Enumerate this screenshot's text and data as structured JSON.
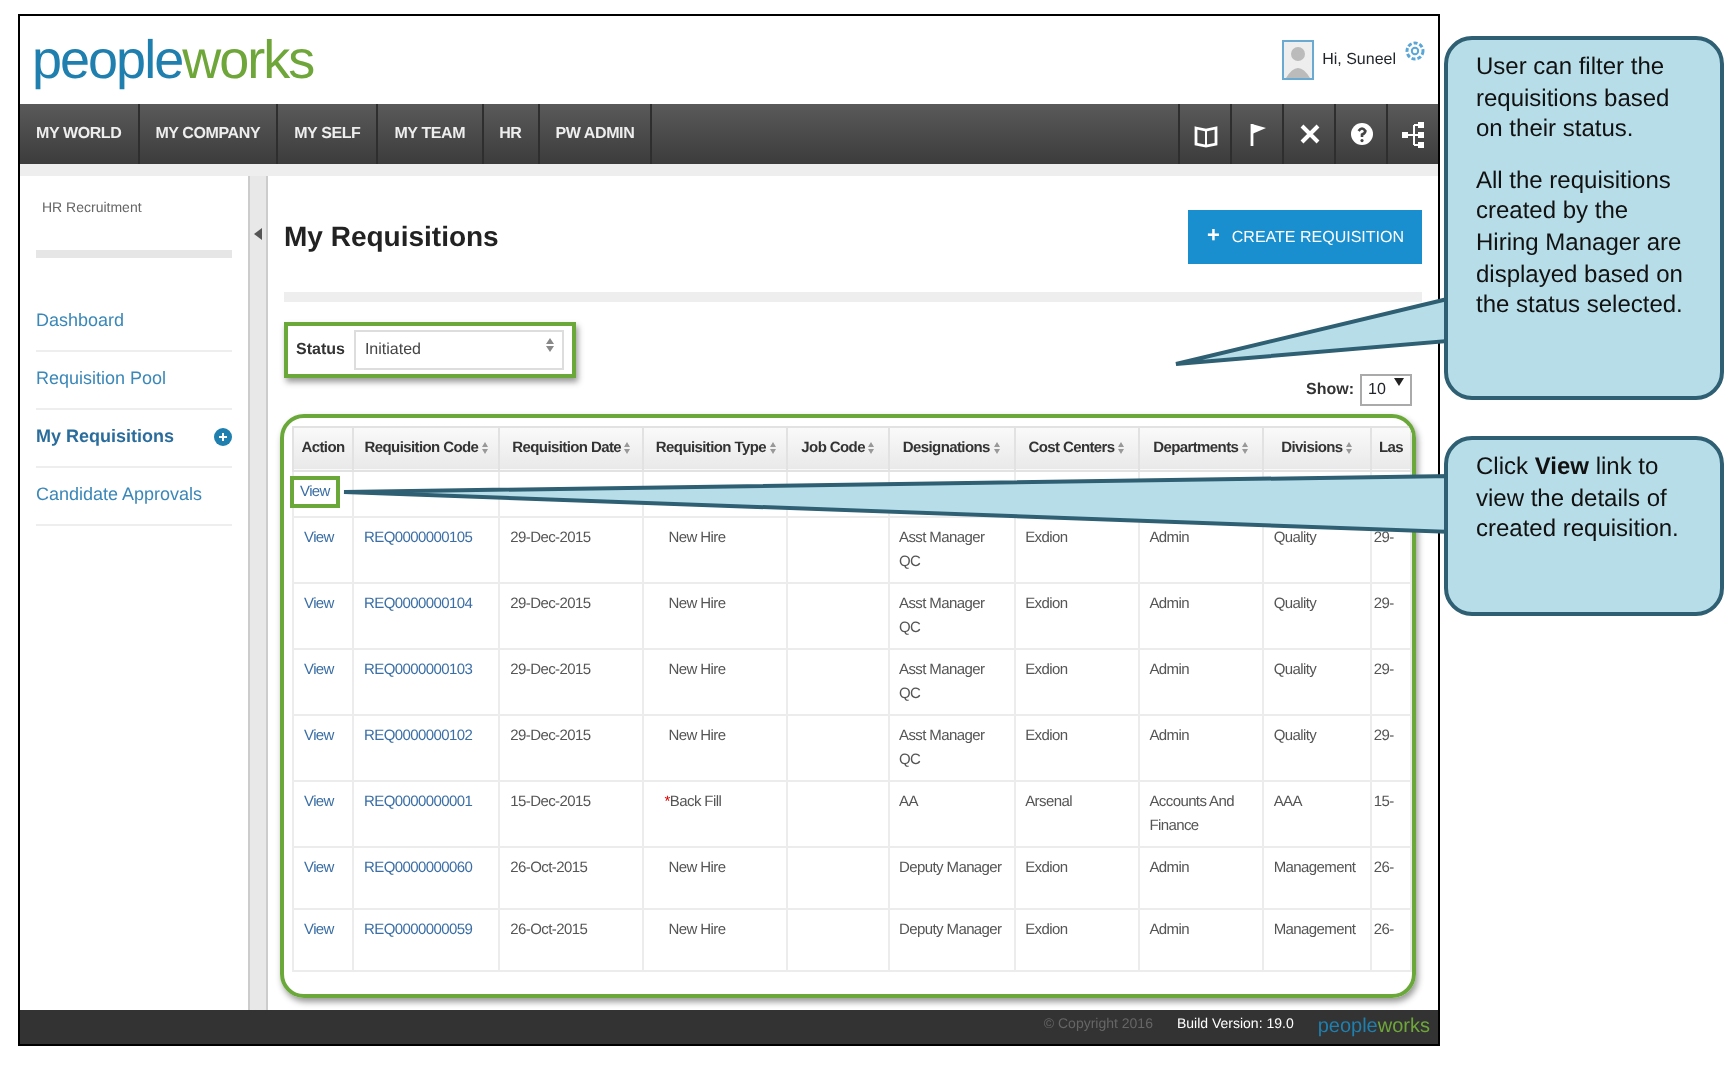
{
  "header": {
    "logo": {
      "first": "people",
      "second": "works"
    },
    "greeting": "Hi, Suneel"
  },
  "nav": {
    "tabs": [
      {
        "label": "MY WORLD"
      },
      {
        "label": "MY COMPANY"
      },
      {
        "label": "MY SELF"
      },
      {
        "label": "MY TEAM"
      },
      {
        "label": "HR"
      },
      {
        "label": "PW ADMIN"
      }
    ]
  },
  "sidebar": {
    "title": "HR Recruitment",
    "items": [
      {
        "label": "Dashboard",
        "selected": false
      },
      {
        "label": "Requisition Pool",
        "selected": false
      },
      {
        "label": "My Requisitions",
        "selected": true
      },
      {
        "label": "Candidate Approvals",
        "selected": false
      }
    ]
  },
  "page": {
    "title": "My Requisitions",
    "create_button": {
      "icon": "+",
      "label": "CREATE REQUISITION"
    },
    "status_filter": {
      "label": "Status",
      "value": "Initiated"
    },
    "show": {
      "label": "Show:",
      "value": "10"
    }
  },
  "table": {
    "columns": [
      "Action",
      "Requisition Code",
      "Requisition Date",
      "Requisition Type",
      "Job Code",
      "Designations",
      "Cost Centers",
      "Departments",
      "Divisions",
      "Las"
    ],
    "rows": [
      {
        "highlighted": true,
        "cells": [
          "View",
          "",
          "",
          "",
          "",
          "",
          "",
          "",
          "",
          ""
        ]
      },
      {
        "highlighted": false,
        "cells": [
          "View",
          "REQ0000000105",
          "29-Dec-2015",
          "New Hire",
          "",
          "Asst Manager QC",
          "Exdion",
          "Admin",
          "Quality",
          "29-"
        ]
      },
      {
        "highlighted": false,
        "cells": [
          "View",
          "REQ0000000104",
          "29-Dec-2015",
          "New Hire",
          "",
          "Asst Manager QC",
          "Exdion",
          "Admin",
          "Quality",
          "29-"
        ]
      },
      {
        "highlighted": false,
        "cells": [
          "View",
          "REQ0000000103",
          "29-Dec-2015",
          "New Hire",
          "",
          "Asst Manager QC",
          "Exdion",
          "Admin",
          "Quality",
          "29-"
        ]
      },
      {
        "highlighted": false,
        "cells": [
          "View",
          "REQ0000000102",
          "29-Dec-2015",
          "New Hire",
          "",
          "Asst Manager QC",
          "Exdion",
          "Admin",
          "Quality",
          "29-"
        ]
      },
      {
        "highlighted": false,
        "marker": "*",
        "cells": [
          "View",
          "REQ0000000001",
          "15-Dec-2015",
          "Back Fill",
          "",
          "AA",
          "Arsenal",
          "Accounts And Finance",
          "AAA",
          "15-"
        ]
      },
      {
        "highlighted": false,
        "cells": [
          "View",
          "REQ0000000060",
          "26-Oct-2015",
          "New Hire",
          "",
          "Deputy Manager",
          "Exdion",
          "Admin",
          "Management",
          "26-"
        ]
      },
      {
        "highlighted": false,
        "cells": [
          "View",
          "REQ0000000059",
          "26-Oct-2015",
          "New Hire",
          "",
          "Deputy Manager",
          "Exdion",
          "Admin",
          "Management",
          "26-"
        ]
      }
    ]
  },
  "footer": {
    "copyright": "© Copyright 2016",
    "build": "Build Version: 19.0",
    "logo": {
      "first": "people",
      "second": "works"
    }
  },
  "callouts": [
    {
      "paragraphs": [
        "User can filter the requisitions based on their status.",
        "All the requisitions created by the Hiring Manager are displayed based on the status selected."
      ]
    },
    {
      "paragraphs": [
        "Click **View** link to view the details of created requisition."
      ]
    }
  ]
}
